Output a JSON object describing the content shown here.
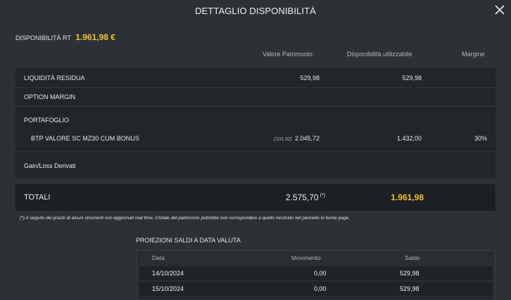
{
  "header": {
    "title": "DETTAGLIO DISPONIBILITÀ",
    "close_icon": "close-icon"
  },
  "disponibilita_rt": {
    "label": "DISPONIBILITÀ RT",
    "value": "1.961,98 €"
  },
  "table": {
    "columns": [
      "Valore Patrimonio",
      "Disponibilità utilizzabile",
      "Margine"
    ],
    "rows": {
      "liquidita": {
        "label": "LIQUIDITÀ RESIDUA",
        "valore": "529,98",
        "disponibilita": "529,98",
        "margine": ""
      },
      "option_margin": {
        "label": "OPTION MARGIN"
      },
      "portafoglio": {
        "label": "PORTAFOGLIO"
      },
      "btp": {
        "label": "BTP VALORE SC MZ30 CUM BONUS",
        "ref": "(101,92)",
        "valore": "2.045,72",
        "disponibilita": "1.432,00",
        "margine": "30%"
      },
      "gainloss": {
        "label": "Gain/Loss Derivati"
      }
    },
    "totali": {
      "label": "TOTALI",
      "valore": "2.575,70",
      "valore_mark": "(*)",
      "disponibilita": "1.961,98"
    }
  },
  "note": "(*) A seguito dei prezzi di alcuni strumenti non aggiornati real time, il totale del patrimonio potrebbe non corrispondere a quello mostrato nel pannello in home page.",
  "proiezioni": {
    "title": "PROIEZIONI SALDI A DATA VALUTA",
    "columns": [
      "Data",
      "Movimento",
      "Saldo"
    ],
    "rows": [
      {
        "data": "14/10/2024",
        "movimento": "0,00",
        "saldo": "529,98"
      },
      {
        "data": "15/10/2024",
        "movimento": "0,00",
        "saldo": "529,98"
      }
    ]
  },
  "colors": {
    "accent": "#f2c230",
    "background": "#2d3136",
    "panel": "#22262a"
  }
}
